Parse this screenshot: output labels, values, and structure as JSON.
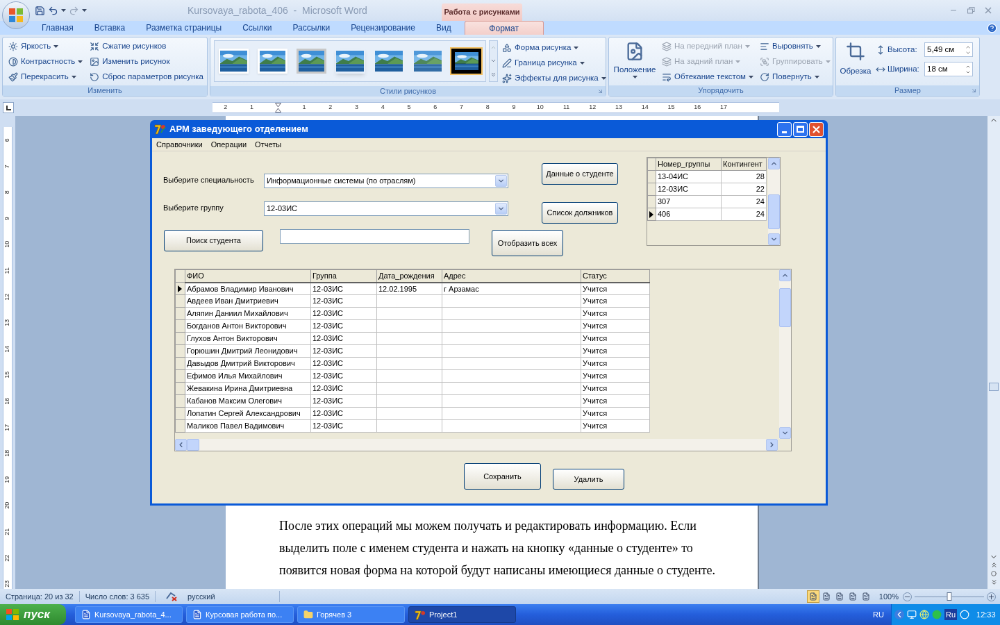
{
  "window": {
    "title": "Kursovaya_rabota_406  -  Microsoft Word",
    "tool_group": "Работа с рисунками"
  },
  "tabs": [
    {
      "label": "Главная",
      "selected": false
    },
    {
      "label": "Вставка",
      "selected": false
    },
    {
      "label": "Разметка страницы",
      "selected": false
    },
    {
      "label": "Ссылки",
      "selected": false
    },
    {
      "label": "Рассылки",
      "selected": false
    },
    {
      "label": "Рецензирование",
      "selected": false
    },
    {
      "label": "Вид",
      "selected": false
    },
    {
      "label": "Формат",
      "selected": true
    }
  ],
  "ribbon": {
    "adjust": {
      "title": "Изменить",
      "columns": [
        [
          {
            "label": "Яркость",
            "dropdown": true,
            "disabled": false
          },
          {
            "label": "Контрастность",
            "dropdown": true,
            "disabled": false
          },
          {
            "label": "Перекрасить",
            "dropdown": true,
            "disabled": false
          }
        ],
        [
          {
            "label": "Сжатие рисунков",
            "dropdown": false,
            "disabled": false
          },
          {
            "label": "Изменить рисунок",
            "dropdown": false,
            "disabled": false
          },
          {
            "label": "Сброс параметров рисунка",
            "dropdown": false,
            "disabled": false
          }
        ]
      ]
    },
    "styles": {
      "title": "Стили рисунков",
      "gallery": [
        {
          "selected": false
        },
        {
          "selected": false
        },
        {
          "selected": false
        },
        {
          "selected": false
        },
        {
          "selected": false
        },
        {
          "selected": false
        },
        {
          "selected": true
        }
      ],
      "commands": [
        {
          "label": "Форма рисунка",
          "dropdown": true,
          "disabled": false
        },
        {
          "label": "Граница рисунка",
          "dropdown": true,
          "disabled": false
        },
        {
          "label": "Эффекты для рисунка",
          "dropdown": true,
          "disabled": false
        }
      ]
    },
    "arrange": {
      "title": "Упорядочить",
      "position": "Положение",
      "columns": [
        [
          {
            "label": "На передний план",
            "dropdown": true,
            "disabled": true
          },
          {
            "label": "На задний план",
            "dropdown": true,
            "disabled": true
          },
          {
            "label": "Обтекание текстом",
            "dropdown": true,
            "disabled": false
          }
        ],
        [
          {
            "label": "Выровнять",
            "dropdown": true,
            "disabled": false
          },
          {
            "label": "Группировать",
            "dropdown": true,
            "disabled": true
          },
          {
            "label": "Повернуть",
            "dropdown": true,
            "disabled": false
          }
        ]
      ]
    },
    "size": {
      "title": "Размер",
      "crop": "Обрезка",
      "height_label": "Высота:",
      "height": "5,49 см",
      "width_label": "Ширина:",
      "width": "18 см"
    }
  },
  "ruler": {
    "left_marks": [
      "2",
      "1"
    ],
    "right_marks": [
      "1",
      "2",
      "3",
      "4",
      "5",
      "6",
      "7",
      "8",
      "9",
      "10",
      "11",
      "12",
      "13",
      "14",
      "15",
      "16",
      "17"
    ],
    "vertical_marks": [
      "6",
      "7",
      "8",
      "9",
      "10",
      "11",
      "12",
      "13",
      "14",
      "15",
      "16",
      "17",
      "18",
      "19",
      "20",
      "21",
      "22",
      "23"
    ]
  },
  "document": {
    "paragraph": "После этих операций мы можем получать и редактировать информацию. Если выделить поле с именем студента и нажать на кнопку «данные о студенте» то появится новая форма на которой будут написаны имеющиеся данные о студенте."
  },
  "status_bar": {
    "page": "Страница: 20 из 32",
    "words": "Число слов: 3 635",
    "language": "русский",
    "views": [
      {
        "selected": true
      },
      {
        "selected": false
      },
      {
        "selected": false
      },
      {
        "selected": false
      },
      {
        "selected": false
      }
    ],
    "zoom": "100%",
    "zoom_slider": {
      "level": 0.5
    }
  },
  "taskbar": {
    "start": "пуск",
    "tasks": [
      {
        "label": "Kursovaya_rabota_4...",
        "kind": "document",
        "selected": false
      },
      {
        "label": "Курсовая работа по...",
        "kind": "document",
        "selected": false
      },
      {
        "label": "Горячев 3",
        "kind": "folder",
        "selected": false
      },
      {
        "label": "Project1",
        "kind": "app",
        "selected": true
      }
    ],
    "language": "RU",
    "tray_language": "Ru",
    "clock": "12:33"
  },
  "form": {
    "title": "АРМ заведующего отделением",
    "menu": [
      "Справочники",
      "Операции",
      "Отчеты"
    ],
    "specialty": {
      "label": "Выберите специальность",
      "value": "Информационные системы (по отраслям)"
    },
    "group": {
      "label": "Выберите группу",
      "value": "12-03ИС"
    },
    "buttons": {
      "student_data": "Данные о студенте",
      "debtors": "Список должников",
      "search": "Поиск студента",
      "show_all": "Отобразить всех",
      "save": "Сохранить",
      "delete": "Удалить"
    },
    "groups_grid": {
      "columns": [
        "Номер_группы",
        "Контингент"
      ],
      "rows": [
        {
          "cells": [
            "13-04ИС",
            "28"
          ],
          "current": false
        },
        {
          "cells": [
            "12-03ИС",
            "22"
          ],
          "current": false
        },
        {
          "cells": [
            "307",
            "24"
          ],
          "current": false
        },
        {
          "cells": [
            "406",
            "24"
          ],
          "current": true
        }
      ]
    },
    "students_grid": {
      "columns": [
        "ФИО",
        "Группа",
        "Дата_рождения",
        "Адрес",
        "Статус"
      ],
      "rows": [
        {
          "name": "Абрамов Владимир Иванович",
          "group": "12-03ИС",
          "birth_date": "12.02.1995",
          "address": "г Арзамас",
          "status": "Учится",
          "current": true
        },
        {
          "name": "Авдеев Иван Дмитриевич",
          "group": "12-03ИС",
          "status": "Учится",
          "current": false
        },
        {
          "name": "Аляпин Даниил Михайлович",
          "group": "12-03ИС",
          "status": "Учится",
          "current": false
        },
        {
          "name": "Богданов Антон Викторович",
          "group": "12-03ИС",
          "status": "Учится",
          "current": false
        },
        {
          "name": "Глухов Антон Викторович",
          "group": "12-03ИС",
          "status": "Учится",
          "current": false
        },
        {
          "name": "Горюшин Дмитрий Леонидович",
          "group": "12-03ИС",
          "status": "Учится",
          "current": false
        },
        {
          "name": "Давыдов Дмитрий Викторович",
          "group": "12-03ИС",
          "status": "Учится",
          "current": false
        },
        {
          "name": "Ефимов Илья Михайлович",
          "group": "12-03ИС",
          "status": "Учится",
          "current": false
        },
        {
          "name": "Жевакина Ирина Дмитриевна",
          "group": "12-03ИС",
          "status": "Учится",
          "current": false
        },
        {
          "name": "Кабанов Максим Олегович",
          "group": "12-03ИС",
          "status": "Учится",
          "current": false
        },
        {
          "name": "Лопатин Сергей Александрович",
          "group": "12-03ИС",
          "status": "Учится",
          "current": false
        },
        {
          "name": "Маликов Павел Вадимович",
          "group": "12-03ИС",
          "status": "Учится",
          "current": false
        }
      ]
    }
  }
}
